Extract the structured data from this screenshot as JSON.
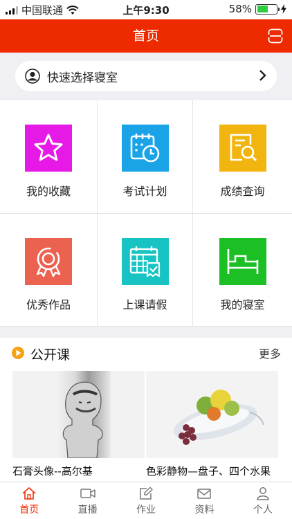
{
  "status_bar": {
    "carrier": "中国联通",
    "time": "上午9:30",
    "battery": "58%",
    "battery_level": 0.58
  },
  "nav": {
    "title": "首页"
  },
  "dorm_selector": {
    "label": "快速选择寝室"
  },
  "grid": [
    {
      "label": "我的收藏",
      "icon": "star-icon",
      "color": "#e619e6"
    },
    {
      "label": "考试计划",
      "icon": "calendar-clock-icon",
      "color": "#1aa3e6"
    },
    {
      "label": "成绩查询",
      "icon": "document-search-icon",
      "color": "#f2b50f"
    },
    {
      "label": "优秀作品",
      "icon": "award-icon",
      "color": "#ec6250"
    },
    {
      "label": "上课请假",
      "icon": "calendar-leave-icon",
      "color": "#18c3c3"
    },
    {
      "label": "我的寝室",
      "icon": "bed-icon",
      "color": "#1cbf24"
    }
  ],
  "open_course": {
    "title": "公开课",
    "more": "更多",
    "items": [
      {
        "caption": "石膏头像--高尔基"
      },
      {
        "caption": "色彩静物—盘子、四个水果"
      }
    ]
  },
  "tabs": [
    {
      "label": "首页",
      "icon": "home-icon",
      "active": true
    },
    {
      "label": "直播",
      "icon": "video-icon",
      "active": false
    },
    {
      "label": "作业",
      "icon": "edit-icon",
      "active": false
    },
    {
      "label": "资料",
      "icon": "mail-icon",
      "active": false
    },
    {
      "label": "个人",
      "icon": "person-icon",
      "active": false
    }
  ]
}
